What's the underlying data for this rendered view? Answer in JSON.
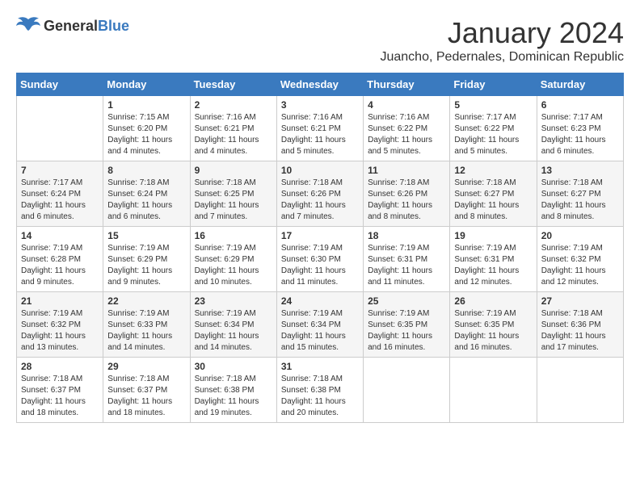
{
  "header": {
    "logo_general": "General",
    "logo_blue": "Blue",
    "month": "January 2024",
    "location": "Juancho, Pedernales, Dominican Republic"
  },
  "days_of_week": [
    "Sunday",
    "Monday",
    "Tuesday",
    "Wednesday",
    "Thursday",
    "Friday",
    "Saturday"
  ],
  "weeks": [
    [
      {
        "day": "",
        "sunrise": "",
        "sunset": "",
        "daylight": ""
      },
      {
        "day": "1",
        "sunrise": "7:15 AM",
        "sunset": "6:20 PM",
        "daylight": "11 hours and 4 minutes."
      },
      {
        "day": "2",
        "sunrise": "7:16 AM",
        "sunset": "6:21 PM",
        "daylight": "11 hours and 4 minutes."
      },
      {
        "day": "3",
        "sunrise": "7:16 AM",
        "sunset": "6:21 PM",
        "daylight": "11 hours and 5 minutes."
      },
      {
        "day": "4",
        "sunrise": "7:16 AM",
        "sunset": "6:22 PM",
        "daylight": "11 hours and 5 minutes."
      },
      {
        "day": "5",
        "sunrise": "7:17 AM",
        "sunset": "6:22 PM",
        "daylight": "11 hours and 5 minutes."
      },
      {
        "day": "6",
        "sunrise": "7:17 AM",
        "sunset": "6:23 PM",
        "daylight": "11 hours and 6 minutes."
      }
    ],
    [
      {
        "day": "7",
        "sunrise": "7:17 AM",
        "sunset": "6:24 PM",
        "daylight": "11 hours and 6 minutes."
      },
      {
        "day": "8",
        "sunrise": "7:18 AM",
        "sunset": "6:24 PM",
        "daylight": "11 hours and 6 minutes."
      },
      {
        "day": "9",
        "sunrise": "7:18 AM",
        "sunset": "6:25 PM",
        "daylight": "11 hours and 7 minutes."
      },
      {
        "day": "10",
        "sunrise": "7:18 AM",
        "sunset": "6:26 PM",
        "daylight": "11 hours and 7 minutes."
      },
      {
        "day": "11",
        "sunrise": "7:18 AM",
        "sunset": "6:26 PM",
        "daylight": "11 hours and 8 minutes."
      },
      {
        "day": "12",
        "sunrise": "7:18 AM",
        "sunset": "6:27 PM",
        "daylight": "11 hours and 8 minutes."
      },
      {
        "day": "13",
        "sunrise": "7:18 AM",
        "sunset": "6:27 PM",
        "daylight": "11 hours and 8 minutes."
      }
    ],
    [
      {
        "day": "14",
        "sunrise": "7:19 AM",
        "sunset": "6:28 PM",
        "daylight": "11 hours and 9 minutes."
      },
      {
        "day": "15",
        "sunrise": "7:19 AM",
        "sunset": "6:29 PM",
        "daylight": "11 hours and 9 minutes."
      },
      {
        "day": "16",
        "sunrise": "7:19 AM",
        "sunset": "6:29 PM",
        "daylight": "11 hours and 10 minutes."
      },
      {
        "day": "17",
        "sunrise": "7:19 AM",
        "sunset": "6:30 PM",
        "daylight": "11 hours and 11 minutes."
      },
      {
        "day": "18",
        "sunrise": "7:19 AM",
        "sunset": "6:31 PM",
        "daylight": "11 hours and 11 minutes."
      },
      {
        "day": "19",
        "sunrise": "7:19 AM",
        "sunset": "6:31 PM",
        "daylight": "11 hours and 12 minutes."
      },
      {
        "day": "20",
        "sunrise": "7:19 AM",
        "sunset": "6:32 PM",
        "daylight": "11 hours and 12 minutes."
      }
    ],
    [
      {
        "day": "21",
        "sunrise": "7:19 AM",
        "sunset": "6:32 PM",
        "daylight": "11 hours and 13 minutes."
      },
      {
        "day": "22",
        "sunrise": "7:19 AM",
        "sunset": "6:33 PM",
        "daylight": "11 hours and 14 minutes."
      },
      {
        "day": "23",
        "sunrise": "7:19 AM",
        "sunset": "6:34 PM",
        "daylight": "11 hours and 14 minutes."
      },
      {
        "day": "24",
        "sunrise": "7:19 AM",
        "sunset": "6:34 PM",
        "daylight": "11 hours and 15 minutes."
      },
      {
        "day": "25",
        "sunrise": "7:19 AM",
        "sunset": "6:35 PM",
        "daylight": "11 hours and 16 minutes."
      },
      {
        "day": "26",
        "sunrise": "7:19 AM",
        "sunset": "6:35 PM",
        "daylight": "11 hours and 16 minutes."
      },
      {
        "day": "27",
        "sunrise": "7:18 AM",
        "sunset": "6:36 PM",
        "daylight": "11 hours and 17 minutes."
      }
    ],
    [
      {
        "day": "28",
        "sunrise": "7:18 AM",
        "sunset": "6:37 PM",
        "daylight": "11 hours and 18 minutes."
      },
      {
        "day": "29",
        "sunrise": "7:18 AM",
        "sunset": "6:37 PM",
        "daylight": "11 hours and 18 minutes."
      },
      {
        "day": "30",
        "sunrise": "7:18 AM",
        "sunset": "6:38 PM",
        "daylight": "11 hours and 19 minutes."
      },
      {
        "day": "31",
        "sunrise": "7:18 AM",
        "sunset": "6:38 PM",
        "daylight": "11 hours and 20 minutes."
      },
      {
        "day": "",
        "sunrise": "",
        "sunset": "",
        "daylight": ""
      },
      {
        "day": "",
        "sunrise": "",
        "sunset": "",
        "daylight": ""
      },
      {
        "day": "",
        "sunrise": "",
        "sunset": "",
        "daylight": ""
      }
    ]
  ]
}
